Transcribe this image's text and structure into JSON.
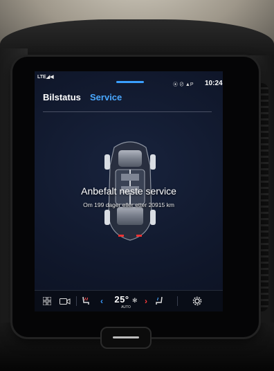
{
  "statusbar": {
    "signal": "LTE◢◀",
    "icons": "⦿ ⊘ ▲P",
    "time": "10:24"
  },
  "tabs": [
    {
      "label": "Bilstatus"
    },
    {
      "label": "Service"
    }
  ],
  "service": {
    "headline": "Anbefalt neste service",
    "detail": "Om 199 dager eller etter 20915 km"
  },
  "climate": {
    "temperature": "25°",
    "mode": "AUTO"
  },
  "colors": {
    "accent": "#4aa8ff",
    "heat": "#ff3b3b"
  }
}
